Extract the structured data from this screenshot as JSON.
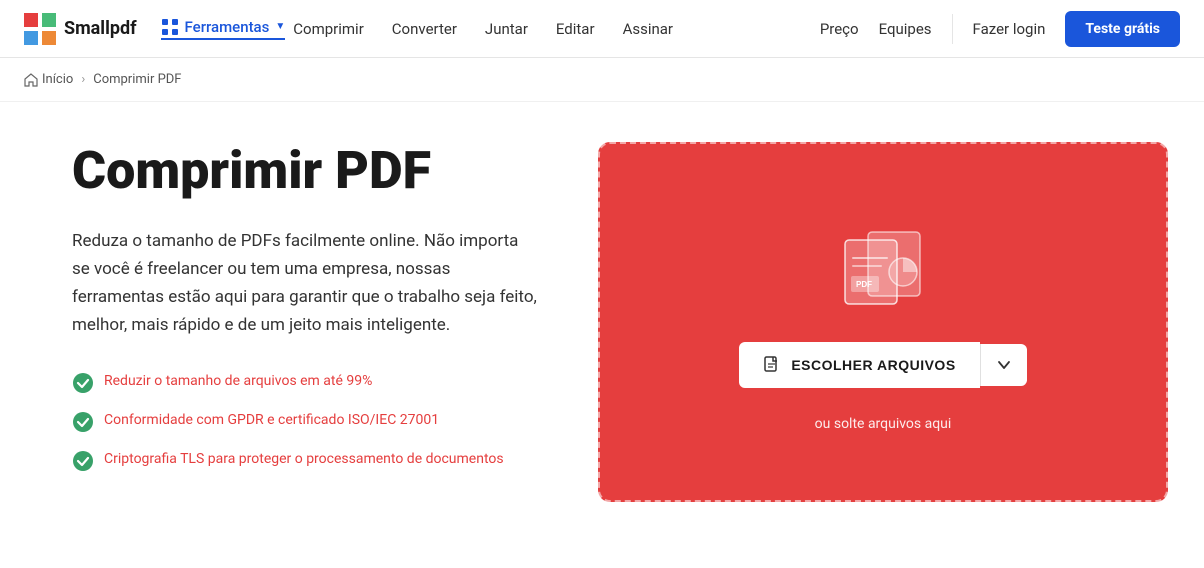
{
  "brand": {
    "name": "Smallpdf"
  },
  "nav": {
    "ferramentas_label": "Ferramentas",
    "links": [
      {
        "id": "comprimir",
        "label": "Comprimir"
      },
      {
        "id": "converter",
        "label": "Converter"
      },
      {
        "id": "juntar",
        "label": "Juntar"
      },
      {
        "id": "editar",
        "label": "Editar"
      },
      {
        "id": "assinar",
        "label": "Assinar"
      }
    ],
    "preco_label": "Preço",
    "equipes_label": "Equipes",
    "login_label": "Fazer login",
    "cta_label": "Teste grátis"
  },
  "breadcrumb": {
    "home_label": "Início",
    "separator": "›",
    "current_label": "Comprimir PDF"
  },
  "hero": {
    "title": "Comprimir PDF",
    "description": "Reduza o tamanho de PDFs facilmente online. Não importa se você é freelancer ou tem uma empresa, nossas ferramentas estão aqui para garantir que o trabalho seja feito, melhor, mais rápido e de um jeito mais inteligente.",
    "features": [
      {
        "id": "f1",
        "text": "Reduzir o tamanho de arquivos em até 99%",
        "has_link": true,
        "link_text": "Reduzir o tamanho de arquivos em até 99%"
      },
      {
        "id": "f2",
        "text": "Conformidade com GPDR e certificado ISO/IEC 27001",
        "has_link": true,
        "link_text": "Conformidade com GPDR e certificado ISO/IEC 27001"
      },
      {
        "id": "f3",
        "text": "Criptografia TLS para proteger o processamento de documentos",
        "has_link": true,
        "link_text": "Criptografia TLS para proteger o processamento de documentos"
      }
    ]
  },
  "upload": {
    "choose_label": "ESCOLHER ARQUIVOS",
    "hint_label": "ou solte arquivos aqui"
  }
}
